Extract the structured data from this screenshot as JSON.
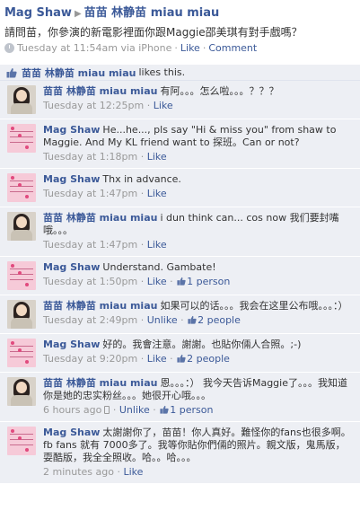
{
  "post": {
    "author": "Mag Shaw",
    "target": "苗苗 林静苗 miau miau",
    "text": "請問苗，你參演的新電影裡面你跟Maggie邵美琪有對手戲嗎？",
    "time": "Tuesday at 11:54am via iPhone",
    "like": "Like",
    "comment": "Comment"
  },
  "likes": {
    "name": "苗苗 林静苗 miau miau",
    "suffix": "likes this."
  },
  "comments": [
    {
      "avatar": "miao",
      "author": "苗苗 林静苗 miau miau",
      "text": "有阿。。。怎么啦。。。？？？",
      "time": "Tuesday at 12:25pm",
      "actions": "Like"
    },
    {
      "avatar": "mag",
      "author": "Mag Shaw",
      "text": "He...he..., pls say \"Hi & miss you\" from shaw to Maggie. And My KL friend want to 探班。Can or not?",
      "time": "Tuesday at 1:18pm",
      "actions": "Like"
    },
    {
      "avatar": "mag",
      "author": "Mag Shaw",
      "text": "Thx in advance.",
      "time": "Tuesday at 1:47pm",
      "actions": "Like"
    },
    {
      "avatar": "miao",
      "author": "苗苗 林静苗 miau miau",
      "text": "i dun think can... cos now 我们要封嘴哦。。。",
      "time": "Tuesday at 1:47pm",
      "actions": "Like"
    },
    {
      "avatar": "mag",
      "author": "Mag Shaw",
      "text": "Understand. Gambate!",
      "time": "Tuesday at 1:50pm",
      "actions": "Like",
      "likes": "1 person"
    },
    {
      "avatar": "miao",
      "author": "苗苗 林静苗 miau miau",
      "text": "如果可以的话。。。我会在这里公布哦。。。：）",
      "time": "Tuesday at 2:49pm",
      "actions": "Unlike",
      "likes": "2 people"
    },
    {
      "avatar": "mag",
      "author": "Mag Shaw",
      "text": "好的。我會注意。謝謝。也貼你倆人合照。;-)",
      "time": "Tuesday at 9:20pm",
      "actions": "Like",
      "likes": "2 people"
    },
    {
      "avatar": "miao",
      "author": "苗苗 林静苗 miau miau",
      "text": "恩。。。：） 我今天告诉Maggie了。。。我知道你是她的忠实粉丝。。。她很开心哦。。。",
      "time": "6 hours ago",
      "actions": "Unlike",
      "likes": "1 person",
      "mobile": true
    },
    {
      "avatar": "mag",
      "author": "Mag Shaw",
      "text": "太謝謝你了，苗苗！你人真好。難怪你的fans也很多啊。fb fans 就有 7000多了。我等你貼你們倆的照片。親文版，鬼馬版，耍酷版，我全全照收。哈。。哈。。。",
      "time": "2 minutes ago",
      "actions": "Like"
    }
  ],
  "colors": {
    "link": "#3b5998",
    "comment_bg": "#edeff4",
    "meta": "#999999"
  }
}
